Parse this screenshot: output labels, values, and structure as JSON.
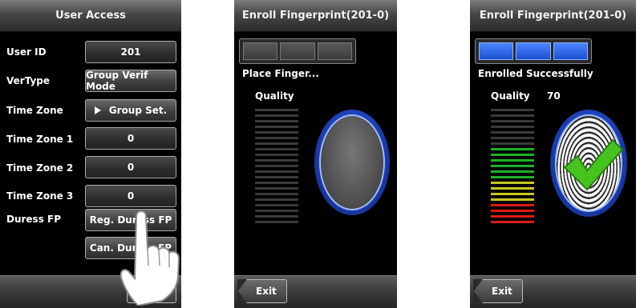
{
  "panel1": {
    "title": "User Access",
    "rows": [
      {
        "label": "User ID",
        "value": "201",
        "style": "dark"
      },
      {
        "label": "VerType",
        "value": "Group Verif Mode",
        "style": "button"
      },
      {
        "label": "Time Zone",
        "value": "Group Set.",
        "style": "button",
        "arrow": true
      },
      {
        "label": "Time Zone 1",
        "value": "0",
        "style": "dark"
      },
      {
        "label": "Time Zone 2",
        "value": "0",
        "style": "dark"
      },
      {
        "label": "Time Zone 3",
        "value": "0",
        "style": "dark"
      },
      {
        "label": "Duress FP",
        "value": "Reg. Duress FP",
        "style": "button"
      },
      {
        "label": "",
        "value": "Can. Duress FP",
        "style": "button"
      }
    ]
  },
  "panel2": {
    "title": "Enroll Fingerprint(201-0)",
    "progress_filled": 0,
    "progress_total": 3,
    "status": "Place Finger...",
    "quality_label": "Quality",
    "quality_value": "",
    "exit_label": "Exit"
  },
  "panel3": {
    "title": "Enroll Fingerprint(201-0)",
    "progress_filled": 3,
    "progress_total": 3,
    "status": "Enrolled Successfully",
    "quality_label": "Quality",
    "quality_value": "70",
    "exit_label": "Exit"
  },
  "colors": {
    "meter_green": "#1fae2a",
    "meter_yellow": "#c8c81e",
    "meter_red": "#e01818",
    "meter_off": "#3a3a3a",
    "progress_on": "#2a63e6",
    "ring_blue": "#2b6cff"
  }
}
